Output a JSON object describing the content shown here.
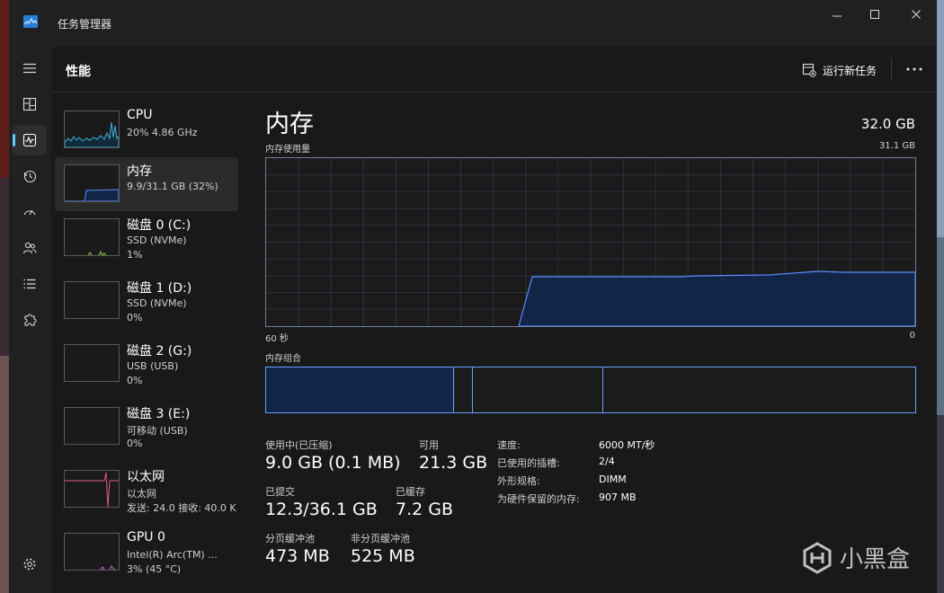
{
  "window": {
    "title": "任务管理器"
  },
  "header": {
    "page_title": "性能",
    "run_new_task": "运行新任务"
  },
  "devices": [
    {
      "name": "CPU",
      "lines": [
        "20% 4.86 GHz"
      ],
      "graph_color": "#3fb0d8"
    },
    {
      "name": "内存",
      "lines": [
        "9.9/31.1 GB (32%)"
      ],
      "graph_color": "#5a8cff"
    },
    {
      "name": "磁盘 0 (C:)",
      "lines": [
        "SSD (NVMe)",
        "1%"
      ],
      "graph_color": "#8fce3f"
    },
    {
      "name": "磁盘 1 (D:)",
      "lines": [
        "SSD (NVMe)",
        "0%"
      ],
      "graph_color": "#8fce3f"
    },
    {
      "name": "磁盘 2 (G:)",
      "lines": [
        "USB (USB)",
        "0%"
      ],
      "graph_color": "#8fce3f"
    },
    {
      "name": "磁盘 3 (E:)",
      "lines": [
        "可移动 (USB)",
        "0%"
      ],
      "graph_color": "#8fce3f"
    },
    {
      "name": "以太网",
      "lines": [
        "以太网",
        "发送: 24.0  接收: 40.0 K"
      ],
      "graph_color": "#e15a8e"
    },
    {
      "name": "GPU 0",
      "lines": [
        "Intel(R) Arc(TM) ...",
        "3% (45 °C)"
      ],
      "graph_color": "#c06ad0"
    }
  ],
  "detail": {
    "title": "内存",
    "total": "32.0 GB",
    "usage_label": "内存使用量",
    "usage_max": "31.1 GB",
    "time_left": "60 秒",
    "time_right": "0",
    "composition_label": "内存组合",
    "stats": {
      "in_use_label": "使用中(已压缩)",
      "in_use_value": "9.0 GB (0.1 MB)",
      "available_label": "可用",
      "available_value": "21.3 GB",
      "committed_label": "已提交",
      "committed_value": "12.3/36.1 GB",
      "cached_label": "已缓存",
      "cached_value": "7.2 GB",
      "paged_label": "分页缓冲池",
      "paged_value": "473 MB",
      "nonpaged_label": "非分页缓冲池",
      "nonpaged_value": "525 MB"
    },
    "specs": {
      "speed_label": "速度:",
      "speed_value": "6000 MT/秒",
      "slots_label": "已使用的插槽:",
      "slots_value": "2/4",
      "form_label": "外形规格:",
      "form_value": "DIMM",
      "reserved_label": "为硬件保留的内存:",
      "reserved_value": "907 MB"
    }
  },
  "watermark": {
    "text": "小黑盒"
  },
  "colors": {
    "accent": "#60cdff",
    "memory_line": "#5a8cff",
    "memory_fill": "#132546"
  }
}
